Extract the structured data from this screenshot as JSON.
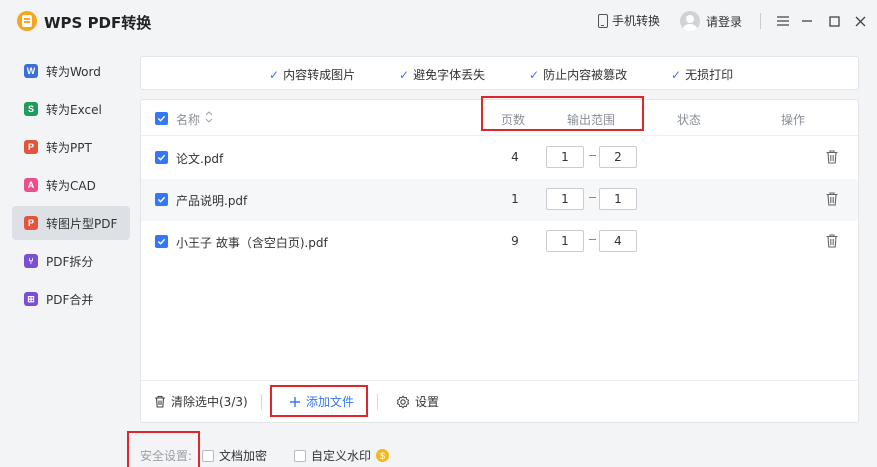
{
  "app": {
    "title": "WPS PDF转换"
  },
  "titlebar": {
    "phone_convert": "手机转换",
    "login": "请登录"
  },
  "sidebar": {
    "items": [
      {
        "label": "转为Word",
        "icon": "word-icon",
        "glyph": "W",
        "color": "#3b6fd8"
      },
      {
        "label": "转为Excel",
        "icon": "excel-icon",
        "glyph": "S",
        "color": "#1f9c5a"
      },
      {
        "label": "转为PPT",
        "icon": "ppt-icon",
        "glyph": "P",
        "color": "#e0553b"
      },
      {
        "label": "转为CAD",
        "icon": "cad-icon",
        "glyph": "A",
        "color": "#e9518e"
      },
      {
        "label": "转图片型PDF",
        "icon": "image-pdf-icon",
        "glyph": "P",
        "color": "#e0553b",
        "active": true
      },
      {
        "label": "PDF拆分",
        "icon": "split-icon",
        "glyph": "⑂",
        "color": "#7a4fd6"
      },
      {
        "label": "PDF合并",
        "icon": "merge-icon",
        "glyph": "⊞",
        "color": "#7a4fd6"
      }
    ]
  },
  "features": [
    "内容转成图片",
    "避免字体丢失",
    "防止内容被篡改",
    "无损打印"
  ],
  "table": {
    "headers": {
      "name": "名称",
      "pages": "页数",
      "range": "输出范围",
      "status": "状态",
      "action": "操作"
    },
    "rows": [
      {
        "name": "论文.pdf",
        "pages": "4",
        "from": "1",
        "to": "2"
      },
      {
        "name": "产品说明.pdf",
        "pages": "1",
        "from": "1",
        "to": "1"
      },
      {
        "name": "小王子 故事（含空白页).pdf",
        "pages": "9",
        "from": "1",
        "to": "4"
      }
    ]
  },
  "footer": {
    "clear": "清除选中(3/3)",
    "add": "添加文件",
    "settings": "设置"
  },
  "security": {
    "label": "安全设置:",
    "encrypt": "文档加密",
    "watermark": "自定义水印"
  },
  "colors": {
    "accent": "#3478f6",
    "annotation": "#e0262a"
  }
}
